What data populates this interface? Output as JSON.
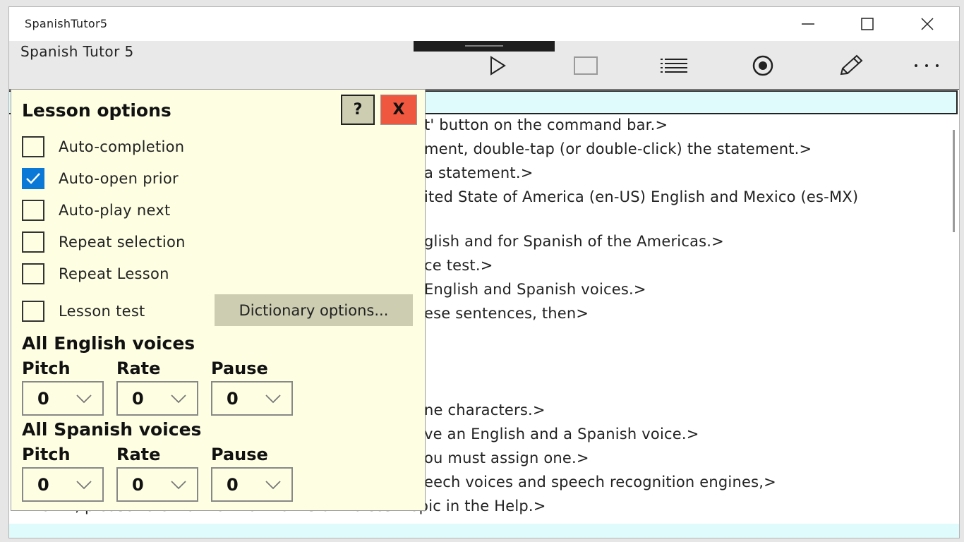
{
  "window": {
    "title": "SpanishTutor5"
  },
  "app": {
    "title": "Spanish Tutor 5"
  },
  "commands": [
    "play-icon",
    "stop-icon",
    "list-icon",
    "record-icon",
    "pencil-icon",
    "more-icon"
  ],
  "content": {
    "lines": [
      "t' button on the command bar.>",
      "ment, double-tap (or double-click) the statement.>",
      "a statement.>",
      "ited State of America (en-US) English and Mexico (es-MX)",
      "glish and for Spanish of the Americas.>",
      "ce test.>",
      " English and Spanish voices.>",
      "ese sentences,  then>",
      "ne characters.>",
      "ve an English and a Spanish voice.>",
      "ou must assign one.>",
      "eech voices and speech recognition engines,>",
      "<31.E, please refer to the \"How to install voices\" topic in the Help.>"
    ]
  },
  "panel": {
    "title": "Lesson options",
    "help_label": "?",
    "close_label": "X",
    "options": [
      {
        "label": "Auto-completion",
        "checked": false
      },
      {
        "label": "Auto-open prior",
        "checked": true
      },
      {
        "label": "Auto-play next",
        "checked": false
      },
      {
        "label": "Repeat selection",
        "checked": false
      },
      {
        "label": "Repeat Lesson",
        "checked": false
      },
      {
        "label": "Lesson test",
        "checked": false
      }
    ],
    "dictionary_button": "Dictionary options...",
    "english": {
      "heading": "All English voices",
      "pitch_label": "Pitch",
      "rate_label": "Rate",
      "pause_label": "Pause",
      "pitch": "0",
      "rate": "0",
      "pause": "0"
    },
    "spanish": {
      "heading": "All Spanish voices",
      "pitch_label": "Pitch",
      "rate_label": "Rate",
      "pause_label": "Pause",
      "pitch": "0",
      "rate": "0",
      "pause": "0"
    }
  },
  "colors": {
    "accent": "#0a78d7",
    "panel_bg": "#fefee3",
    "close_button": "#f0573f",
    "highlight_row": "#e0fbfb"
  }
}
